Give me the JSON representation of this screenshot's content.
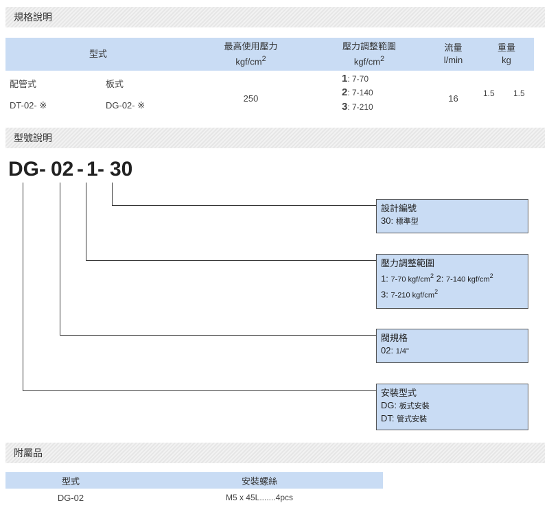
{
  "sections": {
    "spec": "規格說明",
    "model": "型號說明",
    "accessories": "附屬品"
  },
  "spec_table": {
    "headers": {
      "type": "型式",
      "max_pressure": "最高使用壓力",
      "max_pressure_unit": "kgf/cm",
      "pressure_range": "壓力調整範圍",
      "pressure_range_unit": "kgf/cm",
      "flow": "流量",
      "flow_unit": "l/min",
      "weight": "重量",
      "weight_unit": "kg"
    },
    "row": {
      "pipe_label": "配管式",
      "plate_label": "板式",
      "pipe_model": "DT-02- ※",
      "plate_model": "DG-02- ※",
      "max_pressure": "250",
      "range_1_key": "1",
      "range_1_val": ": 7-70",
      "range_2_key": "2",
      "range_2_val": ": 7-140",
      "range_3_key": "3",
      "range_3_val": ": 7-210",
      "flow": "16",
      "weight_pipe": "1.5",
      "weight_plate": "1.5"
    }
  },
  "model_code": {
    "p1": "DG",
    "d1": "-",
    "p2": "02",
    "d2": "-",
    "p3": "1",
    "d3": "-",
    "p4": "30"
  },
  "boxes": {
    "design": {
      "title": "設計編號",
      "key": "30:",
      "val": "標準型"
    },
    "pressure": {
      "title": "壓力調整範圍",
      "k1": "1:",
      "v1": "7-70 kgf/cm",
      "k2": "2:",
      "v2": "7-140 kgf/cm",
      "k3": "3:",
      "v3": "7-210 kgf/cm"
    },
    "size": {
      "title": "閥規格",
      "key": "02:",
      "val": "1/4\""
    },
    "mount": {
      "title": "安裝型式",
      "k1": "DG:",
      "v1": "板式安裝",
      "k2": "DT:",
      "v2": "管式安裝"
    }
  },
  "superscript": "2",
  "accessories_table": {
    "headers": {
      "type": "型式",
      "screw": "安裝螺絲"
    },
    "row": {
      "type": "DG-02",
      "screw": "M5 x 45L.......4pcs"
    }
  }
}
